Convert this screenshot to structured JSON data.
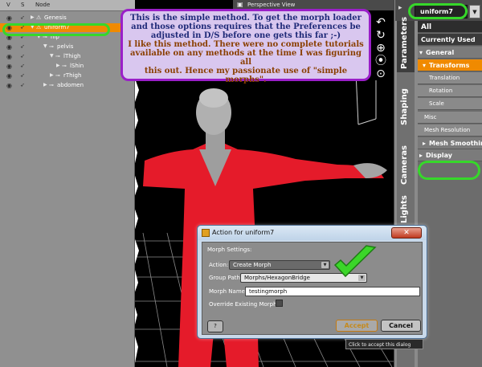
{
  "scene": {
    "header": {
      "v": "V",
      "s": "S",
      "node": "Node"
    },
    "nodes": [
      {
        "label": "Genesis",
        "depth": 0,
        "expanded": false,
        "kind": "figure"
      },
      {
        "label": "uniform7",
        "depth": 0,
        "expanded": true,
        "kind": "figure",
        "selected": true
      },
      {
        "label": "hip",
        "depth": 1,
        "expanded": true,
        "kind": "bone"
      },
      {
        "label": "pelvis",
        "depth": 2,
        "expanded": true,
        "kind": "bone"
      },
      {
        "label": "lThigh",
        "depth": 3,
        "expanded": true,
        "kind": "bone"
      },
      {
        "label": "lShin",
        "depth": 4,
        "expanded": false,
        "kind": "bone"
      },
      {
        "label": "rThigh",
        "depth": 3,
        "expanded": false,
        "kind": "bone"
      },
      {
        "label": "abdomen",
        "depth": 2,
        "expanded": false,
        "kind": "bone"
      }
    ]
  },
  "viewport": {
    "title": "Perspective View"
  },
  "annotation": {
    "line_blue": [
      "This is the simple method. To get the morph loader",
      "and those options requires that the Preferences be",
      "adjusted in D/S before one gets this far ;-)"
    ],
    "line_brown": [
      "I like this method. There were no complete tutorials",
      "available on any methods at the time I was figuring all",
      "this out. Hence my passionate use of \"simple morphs\"."
    ]
  },
  "right_panel": {
    "preset_value": "uniform7",
    "side_tabs": [
      "Parameters",
      "Shaping",
      "Cameras",
      "Lights"
    ],
    "items": [
      {
        "label": "All",
        "kind": "all"
      },
      {
        "label": "Currently Used",
        "kind": "used"
      },
      {
        "label": "General",
        "kind": "group",
        "expanded": true
      },
      {
        "label": "Transforms",
        "kind": "sel",
        "expanded": true
      },
      {
        "label": "Translation",
        "kind": "sub2"
      },
      {
        "label": "Rotation",
        "kind": "sub2"
      },
      {
        "label": "Scale",
        "kind": "sub2"
      },
      {
        "label": "Misc",
        "kind": "sub1"
      },
      {
        "label": "Mesh Resolution",
        "kind": "sub1"
      },
      {
        "label": "Mesh Smoothing",
        "kind": "grpsub",
        "expanded": false
      },
      {
        "label": "Display",
        "kind": "group",
        "expanded": false
      }
    ]
  },
  "dialog": {
    "title": "Action for uniform7",
    "section": "Morph Settings:",
    "action_label": "Action:",
    "action_value": "Create Morph",
    "group_path_label": "Group Path:",
    "group_path_value": "Morphs/HexagonBridge",
    "morph_name_label": "Morph Name:",
    "morph_name_value": "testingmorph",
    "override_label": "Override Existing Morph?",
    "override_checked": false,
    "help_label": "?",
    "accept_label": "Accept",
    "cancel_label": "Cancel",
    "tooltip": "Click to accept this dialog"
  },
  "colors": {
    "highlight_orange": "#f08a00",
    "annotation_green": "#36d82a",
    "note_border": "#9a1fc8",
    "note_bg": "#d9c7ef",
    "figure_red": "#e51b2a"
  }
}
